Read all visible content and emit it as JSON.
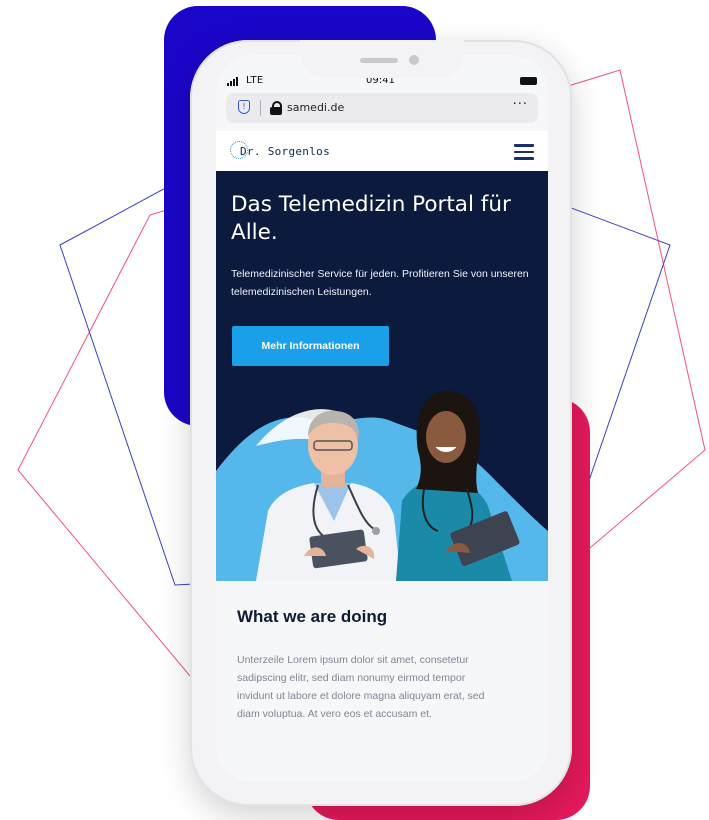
{
  "statusbar": {
    "carrier": "LTE",
    "time": "09:41"
  },
  "browser": {
    "url": "samedi.de",
    "more": "···"
  },
  "site": {
    "logo_text": "Dr. Sorgenlos"
  },
  "hero": {
    "title": "Das Telemedizin Portal für Alle.",
    "subtitle": "Telemedizinischer Service für jeden. Profitieren Sie von unseren telemedizinischen Leistungen.",
    "cta_label": "Mehr Informationen"
  },
  "section": {
    "title": "What we are doing",
    "body": "Unterzeile Lorem ipsum dolor sit amet, consetetur sadipscing elitr, sed diam nonumy eirmod tempor invidunt ut labore et dolore magna aliquyam erat, sed diam voluptua. At vero eos et accusam et."
  },
  "colors": {
    "brand_blue": "#1a06c8",
    "brand_red": "#e5195a",
    "hero_navy": "#0b1a3d",
    "cta_blue": "#1aa0e8",
    "accent_light_blue": "#56b8ea"
  },
  "icons": [
    "signal-icon",
    "battery-icon",
    "shield-icon",
    "lock-icon",
    "more-icon",
    "logo-icon",
    "menu-icon"
  ]
}
